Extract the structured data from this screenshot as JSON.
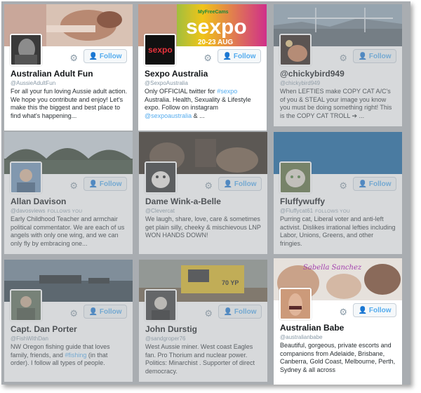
{
  "cards": [
    {
      "name": "Australian Adult Fun",
      "handle": "@AussieAdultFun",
      "follows_you": "",
      "bio": "For all your fun loving Aussie adult action. We hope you contribute and enjoy! Let's make this the biggest and best place to find what's happening...",
      "follow_label": "Follow"
    },
    {
      "name": "Sexpo Australia",
      "handle": "@SexpoAustralia",
      "follows_you": "",
      "bio_parts": [
        "Only OFFICIAL twitter for ",
        "#sexpo",
        " Australia. Health, Sexuality & Lifestyle expo. Follow on instagram ",
        "@sexpoaustralia",
        " & ..."
      ],
      "follow_label": "Follow",
      "banner_logo": "MyFreeCams",
      "banner_title": "sexpo",
      "banner_dates": "20-23 AUG",
      "avatar_text": "sexpo"
    },
    {
      "name": "@chickybird949",
      "handle": "@chickybird949",
      "follows_you": "",
      "bio": "When LEFTIES make COPY CAT A/C's of you & STEAL your image you know you must be doing something right! This is the COPY CAT TROLL ➔ ...",
      "follow_label": "Follow"
    },
    {
      "name": "Allan Davison",
      "handle": "@davosviews",
      "follows_you": "FOLLOWS YOU",
      "bio": "Early Childhood Teacher and armchair political commentator. We are each of us angels with only one wing, and we can only fly by embracing one...",
      "follow_label": "Follow"
    },
    {
      "name": "Dame Wink-a-Belle",
      "handle": "@Clevercat",
      "follows_you": "",
      "bio": "We laugh, share, love, care & sometimes get plain silly, cheeky & mischievous LNP WON HANDS DOWN!",
      "follow_label": "Follow"
    },
    {
      "name": "Fluffywuffy",
      "handle": "@Fluffycat61",
      "follows_you": "FOLLOWS YOU",
      "bio": "Purring cat, Liberal voter and anti-left activist. Dislikes irrational lefties including Labor, Unions, Greens, and other fringies.",
      "follow_label": "Follow"
    },
    {
      "name": "Capt. Dan Porter",
      "handle": "@FishWithDan",
      "follows_you": "",
      "bio_parts": [
        "NW Oregon fishing guide that loves family, friends, and ",
        "#fishing",
        " (in that order). I follow all types of people."
      ],
      "follow_label": "Follow"
    },
    {
      "name": "John Durstig",
      "handle": "@sandgroper76",
      "follows_you": "",
      "bio": "West Aussie miner. West coast Eagles fan. Pro Thorium and nuclear power. Politics: Minarchist . Supporter of direct democracy.",
      "follow_label": "Follow",
      "banner_text": "70 YP"
    },
    {
      "name": "Australian Babe",
      "handle": "@australianbabe",
      "follows_you": "",
      "bio": "Beautiful, gorgeous, private escorts and companions from Adelaide, Brisbane, Canberra, Gold Coast, Melbourne, Perth, Sydney & all across",
      "follow_label": "Follow",
      "banner_script": "Sabella Sanchez"
    }
  ],
  "icons": {
    "gear": "gear-icon",
    "follow": "add-person-icon"
  },
  "colors": {
    "accent": "#55acee",
    "name": "#14171a",
    "muted": "#8899a6",
    "frame": "#a9adb1"
  }
}
